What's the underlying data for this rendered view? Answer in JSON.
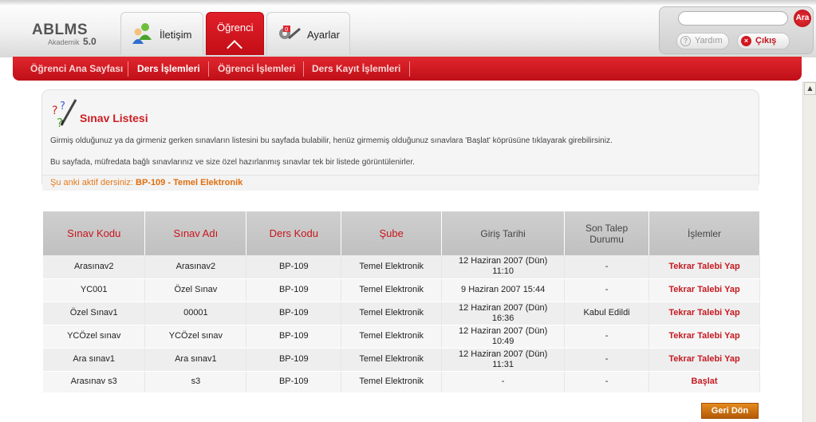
{
  "app": {
    "logo_brand": "ABLMS",
    "logo_sub": "Akademik",
    "logo_version": "5.0"
  },
  "main_tabs": [
    {
      "label": "İletişim",
      "icon": "contact-people-icon",
      "active": false
    },
    {
      "label": "Öğrenci",
      "icon": "student-icon",
      "active": true
    },
    {
      "label": "Ayarlar",
      "icon": "settings-tools-icon",
      "active": false
    }
  ],
  "search": {
    "value": "",
    "placeholder": "",
    "button_label": "Ara"
  },
  "toolbar": {
    "help_label": "Yardım",
    "logout_label": "Çıkış"
  },
  "subnav": [
    {
      "label": "Öğrenci Ana Sayfası",
      "active": false
    },
    {
      "label": "Ders İşlemleri",
      "active": true
    },
    {
      "label": "Öğrenci İşlemleri",
      "active": false
    },
    {
      "label": "Ders Kayıt İşlemleri",
      "active": false
    }
  ],
  "panel": {
    "icon": "quiz-pencil-icon",
    "title": "Sınav Listesi",
    "desc1": "Girmiş olduğunuz ya da girmeniz gerken sınavların listesini bu sayfada bulabilir, henüz girmemiş olduğunuz sınavlara 'Başlat' köprüsüne tıklayarak girebilirsiniz.",
    "desc2": "Bu sayfada, müfredata bağlı sınavlarınız ve size özel hazırlanmış sınavlar tek bir listede görüntülenirler.",
    "active_label": "Şu anki aktif dersiniz:",
    "active_course": "BP-109 - Temel Elektronik"
  },
  "table": {
    "headers": [
      "Sınav Kodu",
      "Sınav Adı",
      "Ders Kodu",
      "Şube",
      "Giriş Tarihi",
      "Son Talep Durumu",
      "İşlemler"
    ],
    "rows": [
      {
        "code": "Arasınav2",
        "name": "Arasınav2",
        "course": "BP-109",
        "branch": "Temel Elektronik",
        "date": "12 Haziran 2007 (Dün) 11:10",
        "status": "-",
        "action": "Tekrar Talebi Yap"
      },
      {
        "code": "YC001",
        "name": "Özel Sınav",
        "course": "BP-109",
        "branch": "Temel Elektronik",
        "date": "9 Haziran 2007 15:44",
        "status": "-",
        "action": "Tekrar Talebi Yap"
      },
      {
        "code": "Özel Sınav1",
        "name": "00001",
        "course": "BP-109",
        "branch": "Temel Elektronik",
        "date": "12 Haziran 2007 (Dün) 16:36",
        "status": "Kabul Edildi",
        "action": "Tekrar Talebi Yap"
      },
      {
        "code": "YCÖzel sınav",
        "name": "YCÖzel sınav",
        "course": "BP-109",
        "branch": "Temel Elektronik",
        "date": "12 Haziran 2007 (Dün) 10:49",
        "status": "-",
        "action": "Tekrar Talebi Yap"
      },
      {
        "code": "Ara sınav1",
        "name": "Ara sınav1",
        "course": "BP-109",
        "branch": "Temel Elektronik",
        "date": "12 Haziran 2007 (Dün) 11:31",
        "status": "-",
        "action": "Tekrar Talebi Yap"
      },
      {
        "code": "Arasınav s3",
        "name": "s3",
        "course": "BP-109",
        "branch": "Temel Elektronik",
        "date": "-",
        "status": "-",
        "action": "Başlat"
      }
    ]
  },
  "back_button": "Geri Dön",
  "colors": {
    "brand_red": "#cc1e24",
    "accent_orange": "#e06e10"
  }
}
